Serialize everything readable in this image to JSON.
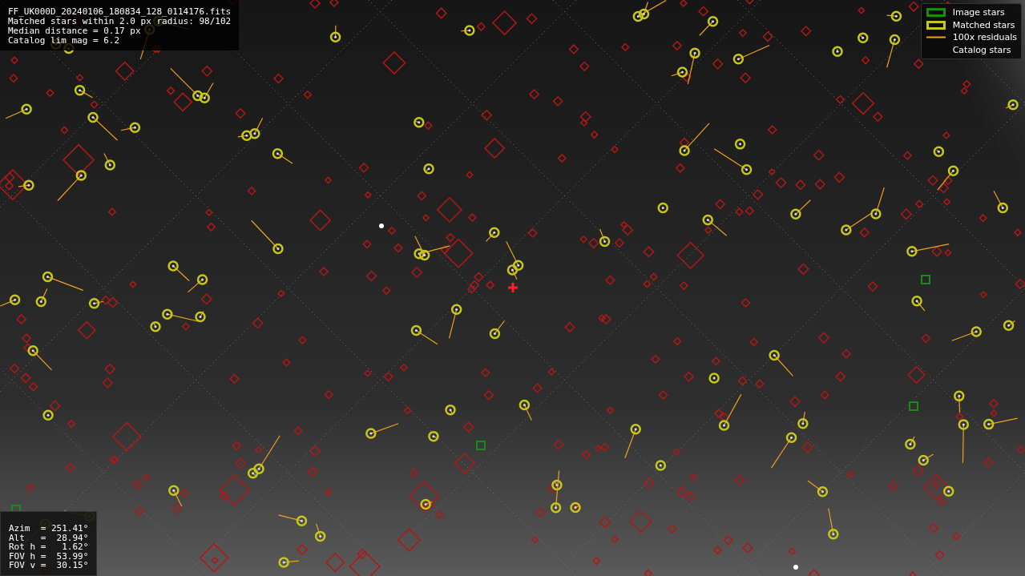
{
  "info_lines": [
    "FF_UK000D_20240106_180834_128_0114176.fits",
    "Matched stars within 2.0 px radius: 98/102",
    "Median distance = 0.17 px",
    "Catalog lim mag = 6.2"
  ],
  "legend": [
    {
      "label": "Image stars",
      "kind": "box",
      "color": "#1a8a1a"
    },
    {
      "label": "Matched stars",
      "kind": "box",
      "color": "#c8c81a"
    },
    {
      "label": "100x residuals",
      "kind": "line",
      "color": "#f0a020"
    },
    {
      "label": "Catalog stars",
      "kind": "none"
    }
  ],
  "pointing_lines": [
    "Azim  = 251.41°",
    "Alt   =  28.94°",
    "Rot h =   1.62°",
    "FOV h =  53.99°",
    "FOV v =  30.15°"
  ]
}
